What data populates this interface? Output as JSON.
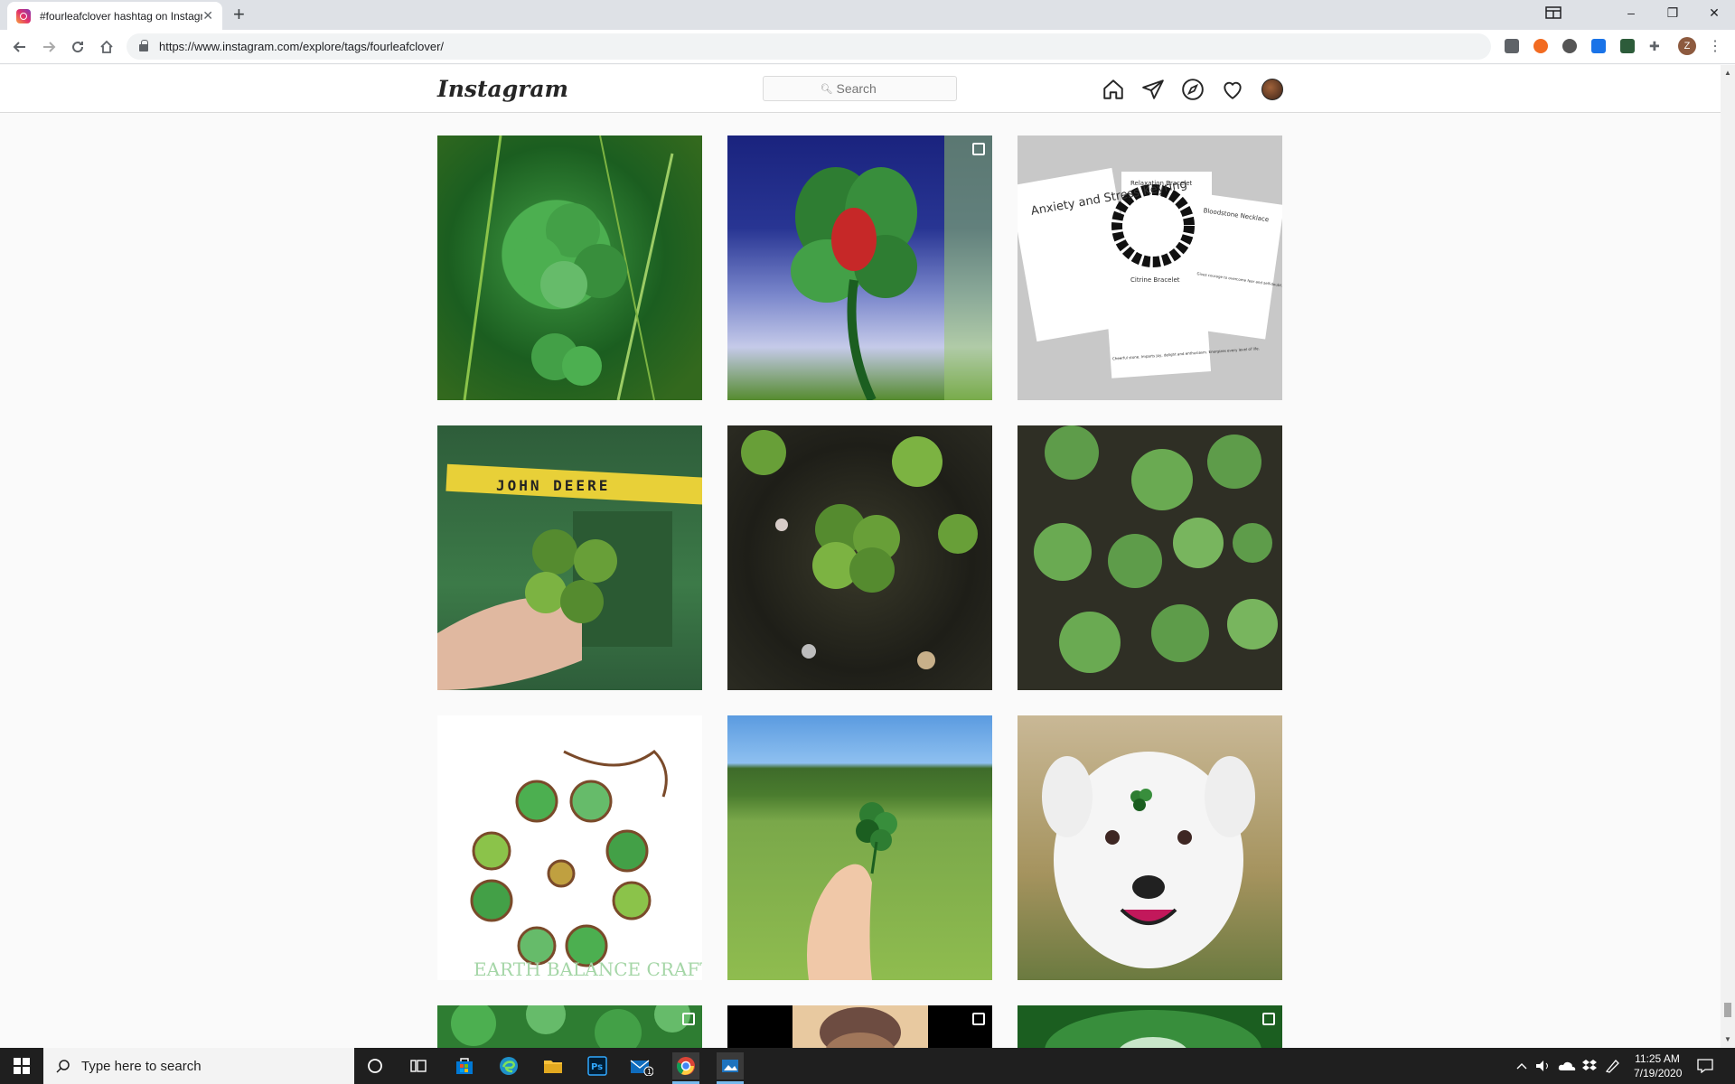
{
  "browser": {
    "tab_title": "#fourleafclover hashtag on Instagram",
    "url": "https://www.instagram.com/explore/tags/fourleafclover/",
    "profile_initial": "Z"
  },
  "instagram": {
    "logo": "Instagram",
    "search_placeholder": "Search"
  },
  "posts": [
    {
      "alt": "clover in grass",
      "multi": false
    },
    {
      "alt": "painted clover",
      "multi": true
    },
    {
      "alt": "bracelet cards",
      "multi": false,
      "cards": {
        "c1": "Anxiety and Stress Keyring",
        "c2": "Relaxation Bracelet",
        "c3": "Bloodstone Necklace",
        "c4": "Citrine Bracelet",
        "c5": "Cheerful stone. Imparts joy, delight and enthusiasm. Energizes every level of life.",
        "c6": "Gives courage to overcome fear and self-doubt. Grounds and protects. Aids with physical, emotional and spiritual healing"
      }
    },
    {
      "alt": "clover near John Deere",
      "multi": false,
      "text": "JOHN DEERE"
    },
    {
      "alt": "clover in soil",
      "multi": false
    },
    {
      "alt": "clover patch",
      "multi": false
    },
    {
      "alt": "wire clover craft",
      "multi": false,
      "watermark": "EARTH BALANCE CRAFT"
    },
    {
      "alt": "clover in field",
      "multi": false
    },
    {
      "alt": "dog with clover",
      "multi": false
    },
    {
      "alt": "clover patch 2",
      "multi": true
    },
    {
      "alt": "braided hair",
      "multi": true
    },
    {
      "alt": "large leaf",
      "multi": true
    }
  ],
  "taskbar": {
    "search_placeholder": "Type here to search",
    "time": "11:25 AM",
    "date": "7/19/2020",
    "mail_badge": "1"
  }
}
